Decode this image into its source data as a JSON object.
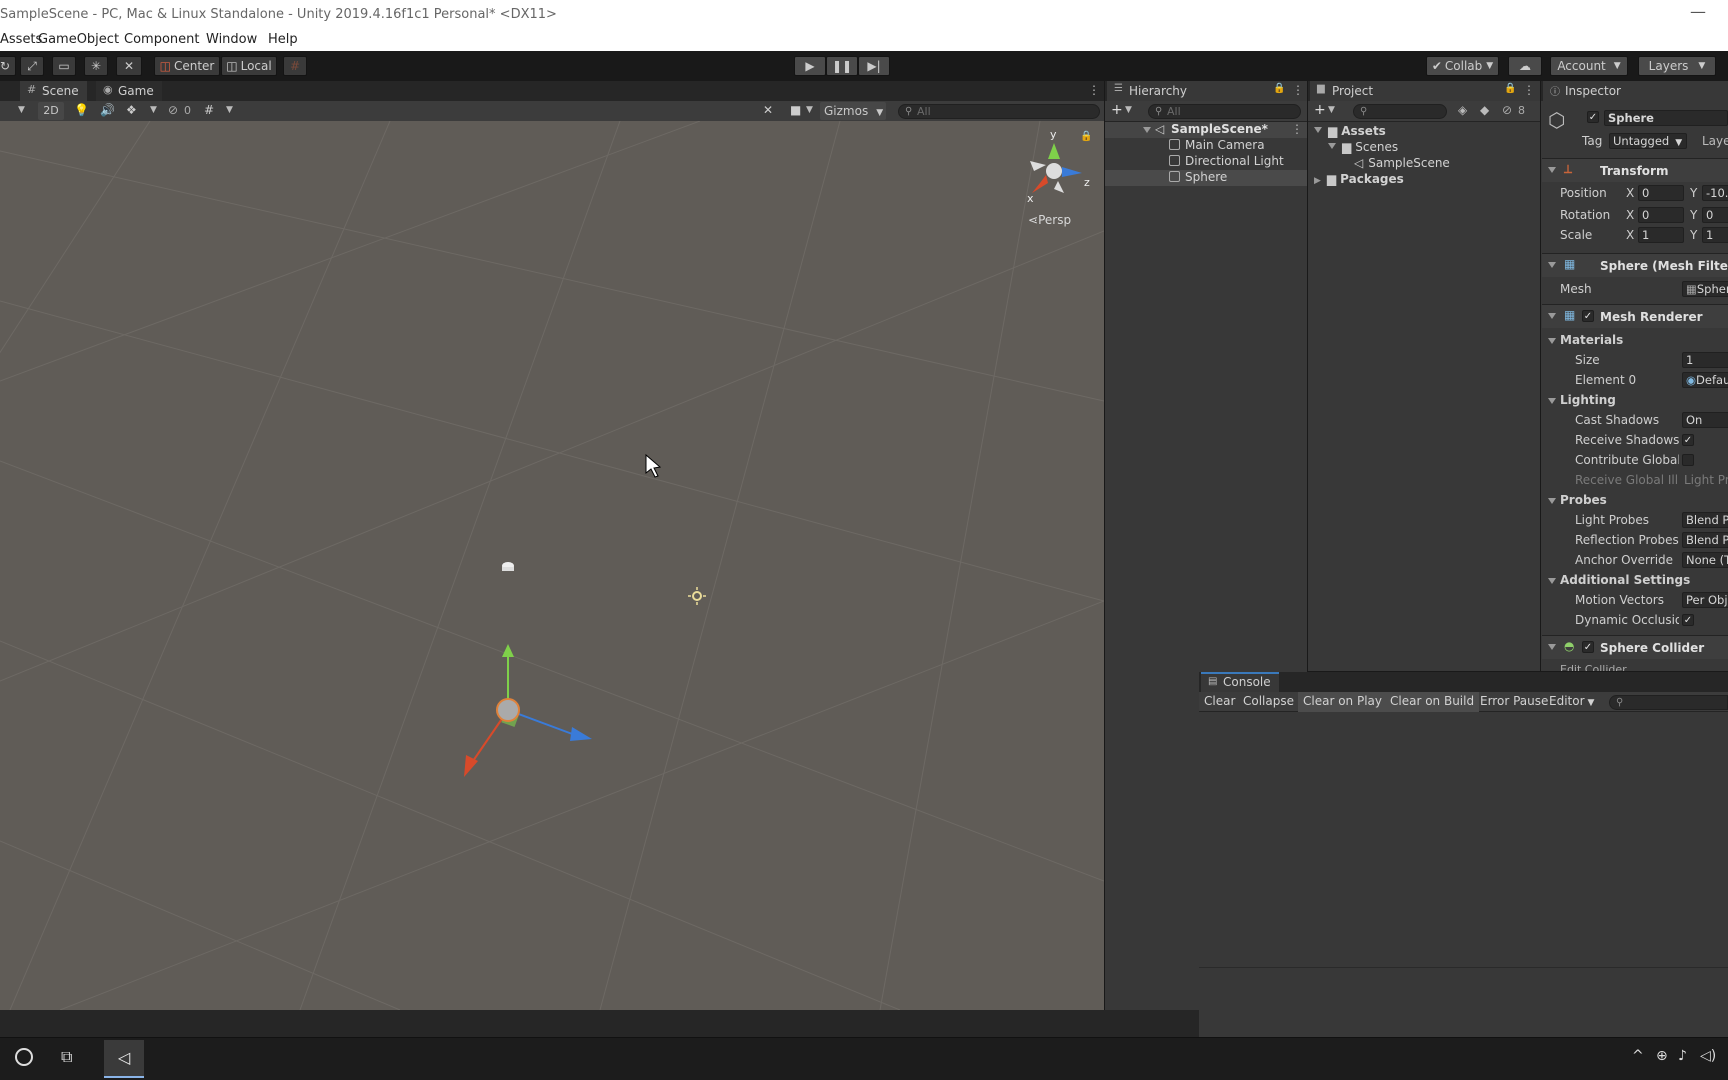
{
  "window": {
    "title": "SampleScene - PC, Mac & Linux Standalone - Unity 2019.4.16f1c1 Personal* <DX11>",
    "minimize": "—"
  },
  "menubar": {
    "items": [
      "Assets",
      "GameObject",
      "Component",
      "Window",
      "Help"
    ]
  },
  "toolbar": {
    "pivot_label": "Center",
    "space_label": "Local",
    "collab_label": "Collab",
    "account_label": "Account",
    "layers_label": "Layers"
  },
  "scene_panel": {
    "tabs": [
      "Scene",
      "Game"
    ],
    "mode_2d": "2D",
    "hidden_count": "0",
    "gizmos_label": "Gizmos",
    "search_placeholder": "All",
    "axis_y": "y",
    "axis_x": "x",
    "axis_z": "z",
    "view_mode": "Persp"
  },
  "hierarchy": {
    "tab": "Hierarchy",
    "search_placeholder": "All",
    "scene_name": "SampleScene*",
    "items": [
      "Main Camera",
      "Directional Light",
      "Sphere"
    ]
  },
  "project": {
    "tab": "Project",
    "hidden_count": "8",
    "assets": "Assets",
    "scenes": "Scenes",
    "scene_file": "SampleScene",
    "packages": "Packages"
  },
  "inspector": {
    "tab": "Inspector",
    "object_name": "Sphere",
    "tag_label": "Tag",
    "tag_value": "Untagged",
    "layer_label": "Laye",
    "transform": {
      "header": "Transform",
      "position_label": "Position",
      "pos_x": "0",
      "pos_y": "-10.",
      "rotation_label": "Rotation",
      "rot_x": "0",
      "rot_y": "0",
      "scale_label": "Scale",
      "scale_x": "1",
      "scale_y": "1",
      "x": "X",
      "y": "Y"
    },
    "mesh_filter": {
      "header": "Sphere (Mesh Filter)",
      "mesh_label": "Mesh",
      "mesh_value": "Spher"
    },
    "mesh_renderer": {
      "header": "Mesh Renderer",
      "materials": "Materials",
      "size_label": "Size",
      "size_value": "1",
      "element0_label": "Element 0",
      "element0_value": "Defau",
      "lighting": "Lighting",
      "cast_shadows_label": "Cast Shadows",
      "cast_shadows_value": "On",
      "receive_shadows_label": "Receive Shadows",
      "contribute_gi_label": "Contribute Global I",
      "receive_gi_label": "Receive Global Illu",
      "receive_gi_value": "Light Pr",
      "probes": "Probes",
      "light_probes_label": "Light Probes",
      "light_probes_value": "Blend P",
      "reflection_probes_label": "Reflection Probes",
      "reflection_probes_value": "Blend P",
      "anchor_override_label": "Anchor Override",
      "anchor_override_value": "None (T",
      "additional": "Additional Settings",
      "motion_vectors_label": "Motion Vectors",
      "motion_vectors_value": "Per Obj",
      "dynamic_occlusion_label": "Dynamic Occlusio"
    },
    "sphere_collider": {
      "header": "Sphere Collider",
      "edit_label": "Edit Collider"
    },
    "check": "✓"
  },
  "console": {
    "tab": "Console",
    "buttons": [
      "Clear",
      "Collapse",
      "Clear on Play",
      "Clear on Build",
      "Error Pause",
      "Editor"
    ]
  }
}
